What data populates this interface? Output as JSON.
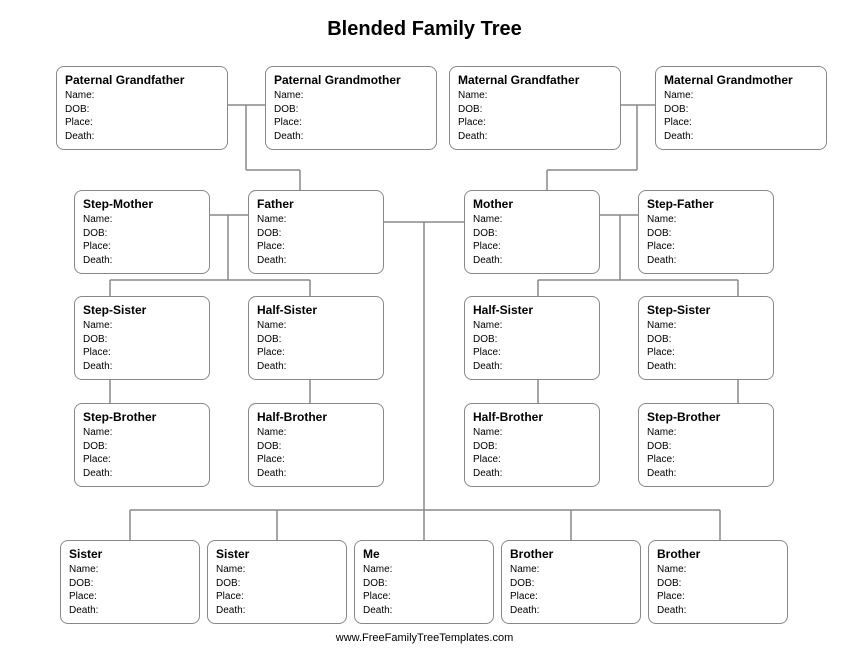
{
  "title": "Blended Family Tree",
  "footer": "www.FreeFamilyTreeTemplates.com",
  "field_labels": {
    "name": "Name:",
    "dob": "DOB:",
    "place": "Place:",
    "death": "Death:"
  },
  "persons": {
    "paternal_grandfather": {
      "heading": "Paternal Grandfather",
      "name": "",
      "dob": "",
      "place": "",
      "death": ""
    },
    "paternal_grandmother": {
      "heading": "Paternal Grandmother",
      "name": "",
      "dob": "",
      "place": "",
      "death": ""
    },
    "maternal_grandfather": {
      "heading": "Maternal Grandfather",
      "name": "",
      "dob": "",
      "place": "",
      "death": ""
    },
    "maternal_grandmother": {
      "heading": "Maternal Grandmother",
      "name": "",
      "dob": "",
      "place": "",
      "death": ""
    },
    "step_mother": {
      "heading": "Step-Mother",
      "name": "",
      "dob": "",
      "place": "",
      "death": ""
    },
    "father": {
      "heading": "Father",
      "name": "",
      "dob": "",
      "place": "",
      "death": ""
    },
    "mother": {
      "heading": "Mother",
      "name": "",
      "dob": "",
      "place": "",
      "death": ""
    },
    "step_father": {
      "heading": "Step-Father",
      "name": "",
      "dob": "",
      "place": "",
      "death": ""
    },
    "step_sister_left": {
      "heading": "Step-Sister",
      "name": "",
      "dob": "",
      "place": "",
      "death": ""
    },
    "half_sister_left": {
      "heading": "Half-Sister",
      "name": "",
      "dob": "",
      "place": "",
      "death": ""
    },
    "half_sister_right": {
      "heading": "Half-Sister",
      "name": "",
      "dob": "",
      "place": "",
      "death": ""
    },
    "step_sister_right": {
      "heading": "Step-Sister",
      "name": "",
      "dob": "",
      "place": "",
      "death": ""
    },
    "step_brother_left": {
      "heading": "Step-Brother",
      "name": "",
      "dob": "",
      "place": "",
      "death": ""
    },
    "half_brother_left": {
      "heading": "Half-Brother",
      "name": "",
      "dob": "",
      "place": "",
      "death": ""
    },
    "half_brother_right": {
      "heading": "Half-Brother",
      "name": "",
      "dob": "",
      "place": "",
      "death": ""
    },
    "step_brother_right": {
      "heading": "Step-Brother",
      "name": "",
      "dob": "",
      "place": "",
      "death": ""
    },
    "sister_1": {
      "heading": "Sister",
      "name": "",
      "dob": "",
      "place": "",
      "death": ""
    },
    "sister_2": {
      "heading": "Sister",
      "name": "",
      "dob": "",
      "place": "",
      "death": ""
    },
    "me": {
      "heading": "Me",
      "name": "",
      "dob": "",
      "place": "",
      "death": ""
    },
    "brother_1": {
      "heading": "Brother",
      "name": "",
      "dob": "",
      "place": "",
      "death": ""
    },
    "brother_2": {
      "heading": "Brother",
      "name": "",
      "dob": "",
      "place": "",
      "death": ""
    }
  }
}
